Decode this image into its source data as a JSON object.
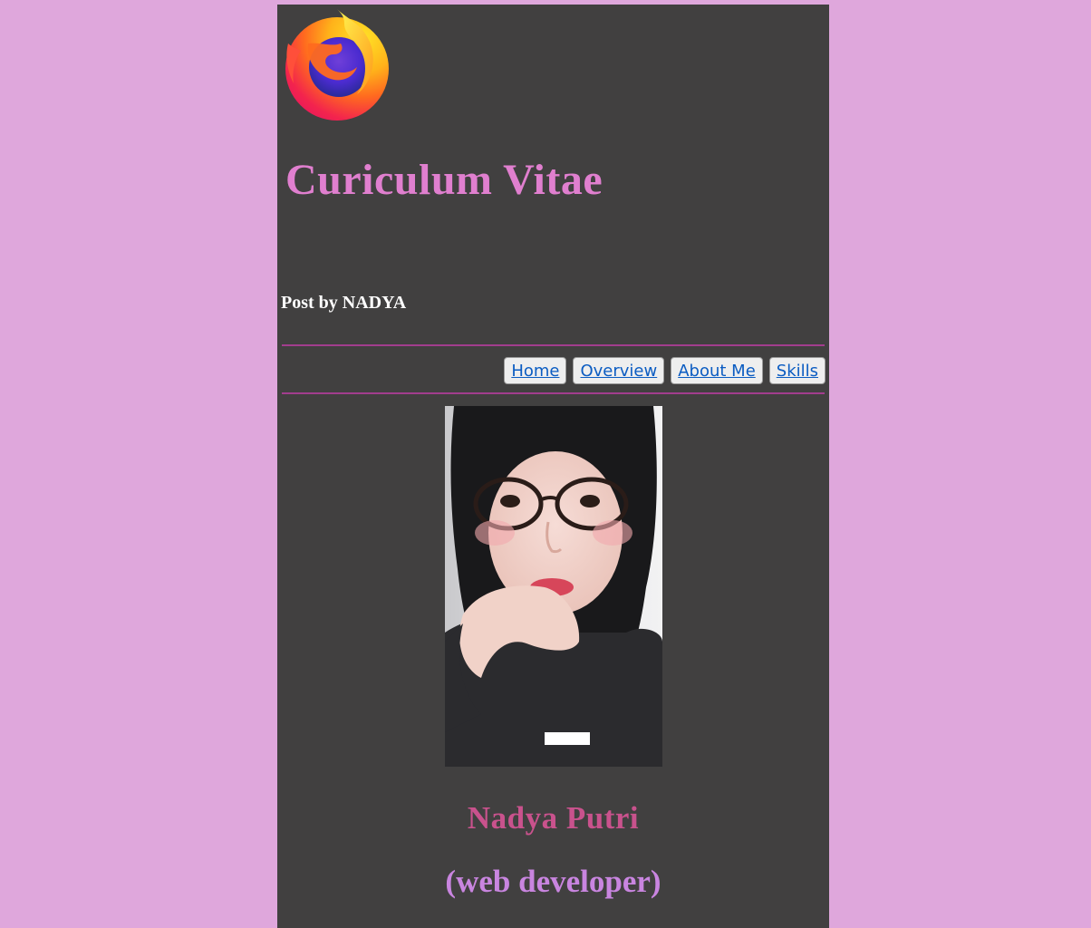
{
  "header": {
    "logo_icon": "firefox-logo",
    "title": "Curiculum Vitae",
    "post_by": "Post by NADYA"
  },
  "nav": {
    "items": [
      {
        "label": "Home"
      },
      {
        "label": "Overview"
      },
      {
        "label": "About Me"
      },
      {
        "label": "Skills"
      }
    ]
  },
  "profile": {
    "photo_icon": "profile-photo",
    "name": "Nadya Putri",
    "role": "(web developer)"
  },
  "colors": {
    "background": "#dfa7dc",
    "panel": "#414040",
    "title": "#e07fcf",
    "rule": "#a23d8e",
    "link": "#0b5cc2",
    "name": "#c9528d",
    "role": "#c985e0"
  }
}
